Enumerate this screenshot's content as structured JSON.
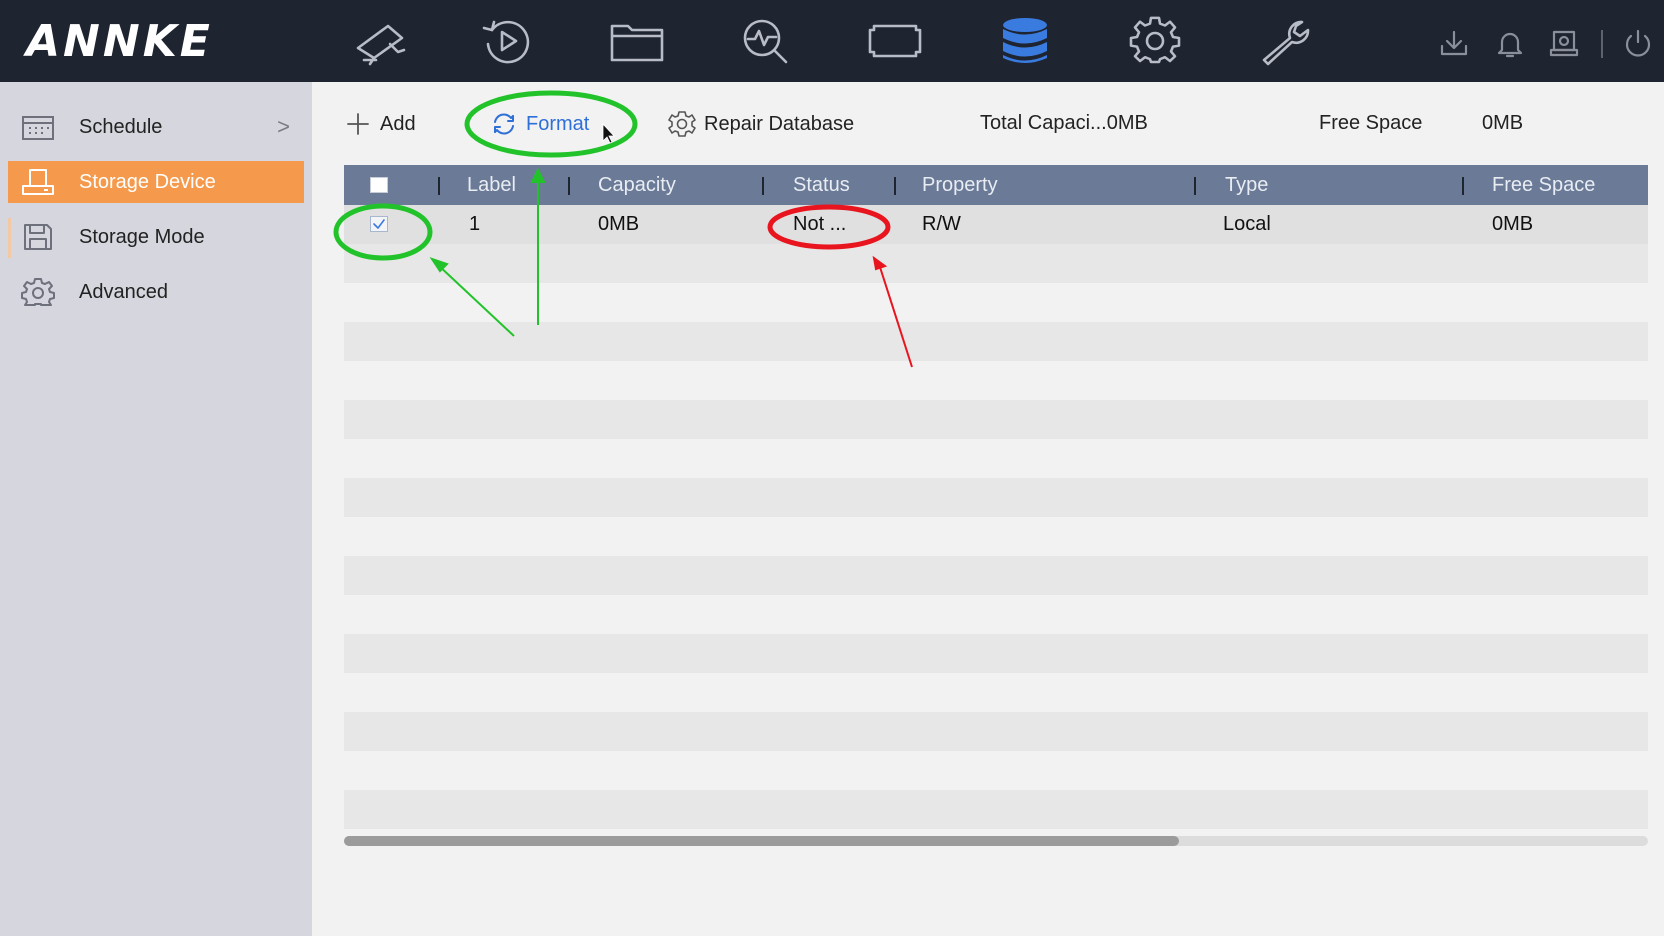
{
  "app": {
    "logo_text": "ANNKE"
  },
  "topnav": {
    "items": [
      {
        "icon": "camera-icon"
      },
      {
        "icon": "playback-icon"
      },
      {
        "icon": "folder-icon"
      },
      {
        "icon": "search-analytics-icon"
      },
      {
        "icon": "ptz-icon"
      },
      {
        "icon": "storage-icon",
        "active": true
      },
      {
        "icon": "gear-icon"
      },
      {
        "icon": "wrench-icon"
      }
    ],
    "utilities": [
      "download-icon",
      "bell-icon",
      "hdd-icon",
      "power-icon"
    ],
    "active_color": "#3a7be0",
    "icon_color": "#b8bcc6"
  },
  "sidebar": {
    "items": [
      {
        "label": "Schedule",
        "icon": "calendar-icon",
        "has_submenu": true
      },
      {
        "label": "Storage Device",
        "icon": "storage-device-icon",
        "active": true
      },
      {
        "label": "Storage Mode",
        "icon": "save-icon"
      },
      {
        "label": "Advanced",
        "icon": "gear-icon"
      }
    ],
    "chevron": ">",
    "active_color": "#f59a4c"
  },
  "toolbar": {
    "add_label": "Add",
    "format_label": "Format",
    "repair_label": "Repair Database",
    "total_capacity_label": "Total Capaci...0MB",
    "free_space_label": "Free Space",
    "free_space_value": "0MB"
  },
  "table": {
    "columns": [
      "Label",
      "Capacity",
      "Status",
      "Property",
      "Type",
      "Free Space"
    ],
    "rows": [
      {
        "checked": true,
        "label": "1",
        "capacity": "0MB",
        "status": "Not ...",
        "property": "R/W",
        "type": "Local",
        "free_space": "0MB"
      }
    ],
    "header_color": "#6b7a96",
    "scroll_fraction": 0.64
  },
  "annotations": {
    "green_color": "#22c32a",
    "red_color": "#e8141e"
  }
}
